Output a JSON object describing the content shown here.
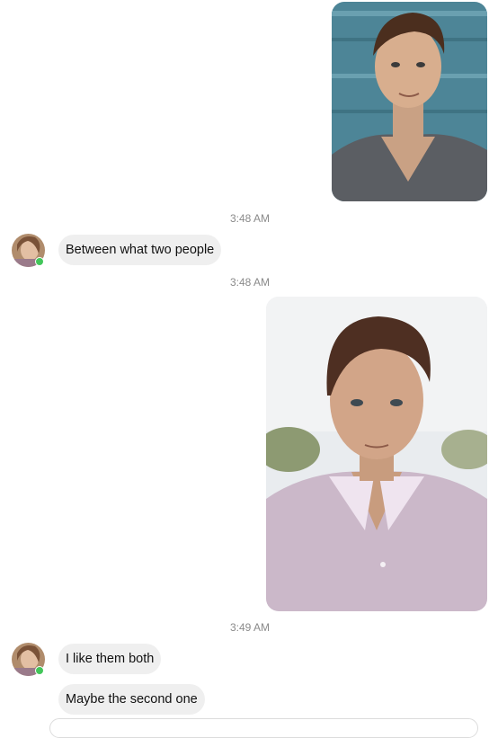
{
  "conversation": {
    "messages": [
      {
        "type": "sent-photo",
        "description_icon": "photo-icon"
      },
      {
        "type": "timestamp",
        "text": "3:48 AM"
      },
      {
        "type": "received-text",
        "text": "Between what two people",
        "sender_online": true
      },
      {
        "type": "timestamp",
        "text": "3:48 AM"
      },
      {
        "type": "sent-photo",
        "description_icon": "photo-icon"
      },
      {
        "type": "timestamp",
        "text": "3:49 AM"
      },
      {
        "type": "received-text",
        "text": "I like them both",
        "sender_online": true
      },
      {
        "type": "received-text",
        "text": "Maybe the second one",
        "sender_online": true
      }
    ]
  },
  "colors": {
    "received_bubble": "#efefef",
    "timestamp_text": "#8a8a8a",
    "online_indicator": "#43c65a",
    "background": "#ffffff"
  }
}
